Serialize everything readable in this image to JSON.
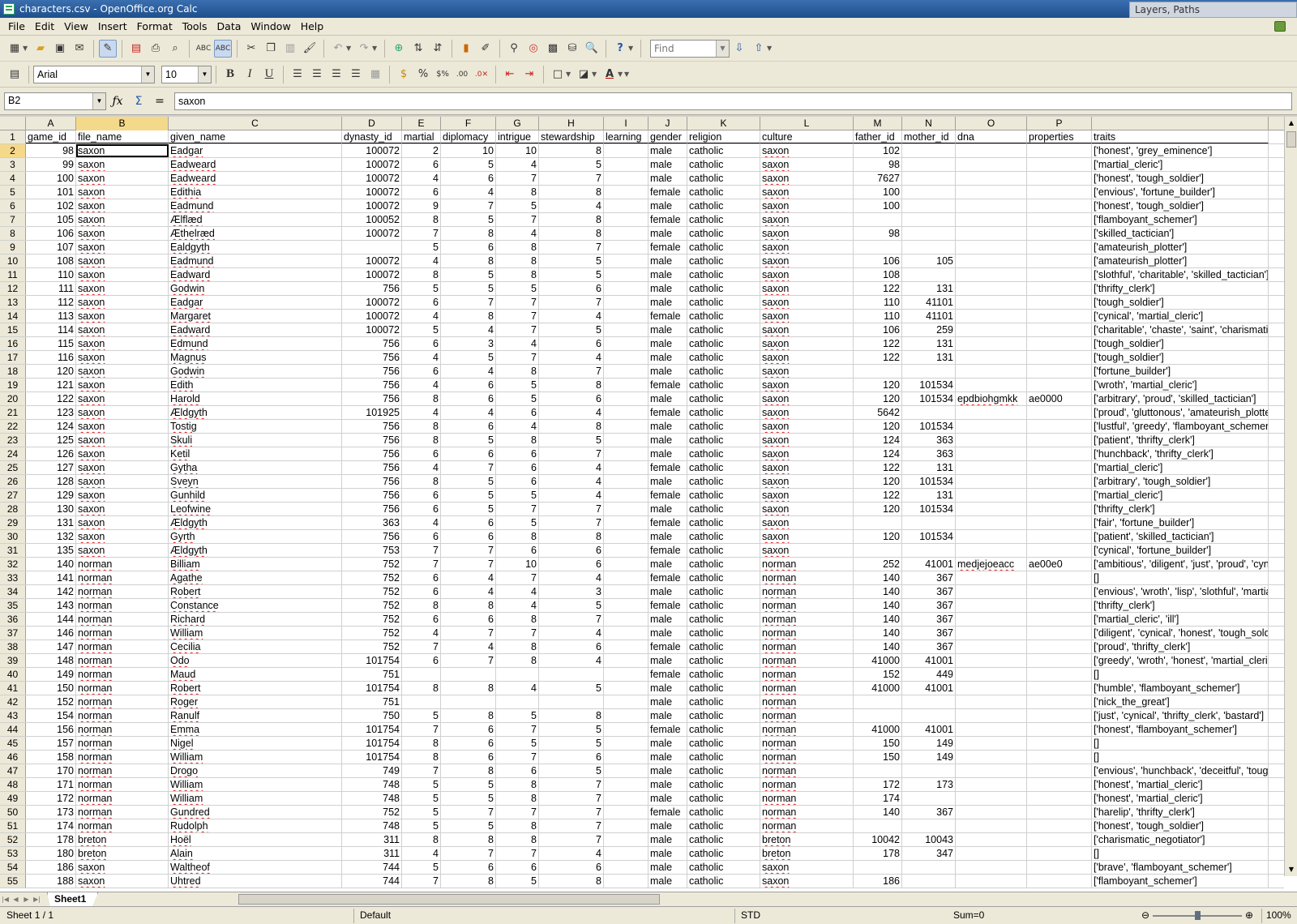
{
  "window": {
    "title": "characters.csv - OpenOffice.org Calc",
    "background_window_title": "Layers, Paths"
  },
  "menu": [
    "File",
    "Edit",
    "View",
    "Insert",
    "Format",
    "Tools",
    "Data",
    "Window",
    "Help"
  ],
  "toolbar": {
    "find_placeholder": "Find",
    "font_name": "Arial",
    "font_size": "10"
  },
  "formula_bar": {
    "cell_ref": "B2",
    "content": "saxon"
  },
  "columns": [
    "A",
    "B",
    "C",
    "D",
    "E",
    "F",
    "G",
    "H",
    "I",
    "J",
    "K",
    "L",
    "M",
    "N",
    "O",
    "P",
    ""
  ],
  "selected_column": "B",
  "active_cell": {
    "row": 2,
    "col": "B"
  },
  "header_row": [
    "game_id",
    "file_name",
    "given_name",
    "dynasty_id",
    "martial",
    "diplomacy",
    "intrigue",
    "stewardship",
    "learning",
    "gender",
    "religion",
    "culture",
    "father_id",
    "mother_id",
    "dna",
    "properties",
    "traits"
  ],
  "rows": [
    [
      2,
      98,
      "saxon",
      "Eadgar",
      100072,
      2,
      10,
      10,
      8,
      "",
      "male",
      "catholic",
      "saxon",
      102,
      "",
      "",
      "",
      "['honest', 'grey_eminence']"
    ],
    [
      3,
      99,
      "saxon",
      "Eadweard",
      100072,
      6,
      5,
      4,
      5,
      "",
      "male",
      "catholic",
      "saxon",
      98,
      "",
      "",
      "",
      "['martial_cleric']"
    ],
    [
      4,
      100,
      "saxon",
      "Eadweard",
      100072,
      4,
      6,
      7,
      7,
      "",
      "male",
      "catholic",
      "saxon",
      7627,
      "",
      "",
      "",
      "['honest', 'tough_soldier']"
    ],
    [
      5,
      101,
      "saxon",
      "Edithia",
      100072,
      6,
      4,
      8,
      8,
      "",
      "female",
      "catholic",
      "saxon",
      100,
      "",
      "",
      "",
      "['envious', 'fortune_builder']"
    ],
    [
      6,
      102,
      "saxon",
      "Eadmund",
      100072,
      9,
      7,
      5,
      4,
      "",
      "male",
      "catholic",
      "saxon",
      100,
      "",
      "",
      "",
      "['honest', 'tough_soldier']"
    ],
    [
      7,
      105,
      "saxon",
      "Ælflæd",
      100052,
      8,
      5,
      7,
      8,
      "",
      "female",
      "catholic",
      "saxon",
      "",
      "",
      "",
      "",
      "['flamboyant_schemer']"
    ],
    [
      8,
      106,
      "saxon",
      "Æthelræd",
      100072,
      7,
      8,
      4,
      8,
      "",
      "male",
      "catholic",
      "saxon",
      98,
      "",
      "",
      "",
      "['skilled_tactician']"
    ],
    [
      9,
      107,
      "saxon",
      "Ealdgyth",
      "",
      5,
      6,
      8,
      7,
      "",
      "female",
      "catholic",
      "saxon",
      "",
      "",
      "",
      "",
      "['amateurish_plotter']"
    ],
    [
      10,
      108,
      "saxon",
      "Eadmund",
      100072,
      4,
      8,
      8,
      5,
      "",
      "male",
      "catholic",
      "saxon",
      106,
      105,
      "",
      "",
      "['amateurish_plotter']"
    ],
    [
      11,
      110,
      "saxon",
      "Eadward",
      100072,
      8,
      5,
      8,
      5,
      "",
      "male",
      "catholic",
      "saxon",
      108,
      "",
      "",
      "",
      "['slothful', 'charitable', 'skilled_tactician']"
    ],
    [
      12,
      111,
      "saxon",
      "Godwin",
      756,
      5,
      5,
      5,
      6,
      "",
      "male",
      "catholic",
      "saxon",
      122,
      131,
      "",
      "",
      "['thrifty_clerk']"
    ],
    [
      13,
      112,
      "saxon",
      "Eadgar",
      100072,
      6,
      7,
      7,
      7,
      "",
      "male",
      "catholic",
      "saxon",
      110,
      41101,
      "",
      "",
      "['tough_soldier']"
    ],
    [
      14,
      113,
      "saxon",
      "Margaret",
      100072,
      4,
      8,
      7,
      4,
      "",
      "female",
      "catholic",
      "saxon",
      110,
      41101,
      "",
      "",
      "['cynical', 'martial_cleric']"
    ],
    [
      15,
      114,
      "saxon",
      "Eadward",
      100072,
      5,
      4,
      7,
      5,
      "",
      "male",
      "catholic",
      "saxon",
      106,
      259,
      "",
      "",
      "['charitable', 'chaste', 'saint', 'charismatic_negotiator']"
    ],
    [
      16,
      115,
      "saxon",
      "Edmund",
      756,
      6,
      3,
      4,
      6,
      "",
      "male",
      "catholic",
      "saxon",
      122,
      131,
      "",
      "",
      "['tough_soldier']"
    ],
    [
      17,
      116,
      "saxon",
      "Magnus",
      756,
      4,
      5,
      7,
      4,
      "",
      "male",
      "catholic",
      "saxon",
      122,
      131,
      "",
      "",
      "['tough_soldier']"
    ],
    [
      18,
      120,
      "saxon",
      "Godwin",
      756,
      6,
      4,
      8,
      7,
      "",
      "male",
      "catholic",
      "saxon",
      "",
      "",
      "",
      "",
      "['fortune_builder']"
    ],
    [
      19,
      121,
      "saxon",
      "Edith",
      756,
      4,
      6,
      5,
      8,
      "",
      "female",
      "catholic",
      "saxon",
      120,
      101534,
      "",
      "",
      "['wroth', 'martial_cleric']"
    ],
    [
      20,
      122,
      "saxon",
      "Harold",
      756,
      8,
      6,
      5,
      6,
      "",
      "male",
      "catholic",
      "saxon",
      120,
      101534,
      "epdbiohgmkk",
      "ae0000",
      "['arbitrary', 'proud', 'skilled_tactician']"
    ],
    [
      21,
      123,
      "saxon",
      "Ældgyth",
      101925,
      4,
      4,
      6,
      4,
      "",
      "female",
      "catholic",
      "saxon",
      5642,
      "",
      "",
      "",
      "['proud', 'gluttonous', 'amateurish_plotter']"
    ],
    [
      22,
      124,
      "saxon",
      "Tostig",
      756,
      8,
      6,
      4,
      8,
      "",
      "male",
      "catholic",
      "saxon",
      120,
      101534,
      "",
      "",
      "['lustful', 'greedy', 'flamboyant_schemer']"
    ],
    [
      23,
      125,
      "saxon",
      "Skuli",
      756,
      8,
      5,
      8,
      5,
      "",
      "male",
      "catholic",
      "saxon",
      124,
      363,
      "",
      "",
      "['patient', 'thrifty_clerk']"
    ],
    [
      24,
      126,
      "saxon",
      "Ketil",
      756,
      6,
      6,
      6,
      7,
      "",
      "male",
      "catholic",
      "saxon",
      124,
      363,
      "",
      "",
      "['hunchback', 'thrifty_clerk']"
    ],
    [
      25,
      127,
      "saxon",
      "Gytha",
      756,
      4,
      7,
      6,
      4,
      "",
      "female",
      "catholic",
      "saxon",
      122,
      131,
      "",
      "",
      "['martial_cleric']"
    ],
    [
      26,
      128,
      "saxon",
      "Sveyn",
      756,
      8,
      5,
      6,
      4,
      "",
      "male",
      "catholic",
      "saxon",
      120,
      101534,
      "",
      "",
      "['arbitrary', 'tough_soldier']"
    ],
    [
      27,
      129,
      "saxon",
      "Gunhild",
      756,
      6,
      5,
      5,
      4,
      "",
      "female",
      "catholic",
      "saxon",
      122,
      131,
      "",
      "",
      "['martial_cleric']"
    ],
    [
      28,
      130,
      "saxon",
      "Leofwine",
      756,
      6,
      5,
      7,
      7,
      "",
      "male",
      "catholic",
      "saxon",
      120,
      101534,
      "",
      "",
      "['thrifty_clerk']"
    ],
    [
      29,
      131,
      "saxon",
      "Ældgyth",
      363,
      4,
      6,
      5,
      7,
      "",
      "female",
      "catholic",
      "saxon",
      "",
      "",
      "",
      "",
      "['fair', 'fortune_builder']"
    ],
    [
      30,
      132,
      "saxon",
      "Gyrth",
      756,
      6,
      6,
      8,
      8,
      "",
      "male",
      "catholic",
      "saxon",
      120,
      101534,
      "",
      "",
      "['patient', 'skilled_tactician']"
    ],
    [
      31,
      135,
      "saxon",
      "Ældgyth",
      753,
      7,
      7,
      6,
      6,
      "",
      "female",
      "catholic",
      "saxon",
      "",
      "",
      "",
      "",
      "['cynical', 'fortune_builder']"
    ],
    [
      32,
      140,
      "norman",
      "Billiam",
      752,
      7,
      7,
      10,
      6,
      "",
      "male",
      "catholic",
      "norman",
      252,
      41001,
      "medjejoeacc",
      "ae00e0",
      "['ambitious', 'diligent', 'just', 'proud', 'cynical']"
    ],
    [
      33,
      141,
      "norman",
      "Agathe",
      752,
      6,
      4,
      7,
      4,
      "",
      "female",
      "catholic",
      "norman",
      140,
      367,
      "",
      "",
      "[]"
    ],
    [
      34,
      142,
      "norman",
      "Robert",
      752,
      6,
      4,
      4,
      3,
      "",
      "male",
      "catholic",
      "norman",
      140,
      367,
      "",
      "",
      "['envious', 'wroth', 'lisp', 'slothful', 'martial_cleric']"
    ],
    [
      35,
      143,
      "norman",
      "Constance",
      752,
      8,
      8,
      4,
      5,
      "",
      "female",
      "catholic",
      "norman",
      140,
      367,
      "",
      "",
      "['thrifty_clerk']"
    ],
    [
      36,
      144,
      "norman",
      "Richard",
      752,
      6,
      6,
      8,
      7,
      "",
      "male",
      "catholic",
      "norman",
      140,
      367,
      "",
      "",
      "['martial_cleric', 'ill']"
    ],
    [
      37,
      146,
      "norman",
      "William",
      752,
      4,
      7,
      7,
      4,
      "",
      "male",
      "catholic",
      "norman",
      140,
      367,
      "",
      "",
      "['diligent', 'cynical', 'honest', 'tough_soldier']"
    ],
    [
      38,
      147,
      "norman",
      "Cecilia",
      752,
      7,
      4,
      8,
      6,
      "",
      "female",
      "catholic",
      "norman",
      140,
      367,
      "",
      "",
      "['proud', 'thrifty_clerk']"
    ],
    [
      39,
      148,
      "norman",
      "Odo",
      101754,
      6,
      7,
      8,
      4,
      "",
      "male",
      "catholic",
      "norman",
      41000,
      41001,
      "",
      "",
      "['greedy', 'wroth', 'honest', 'martial_cleric']"
    ],
    [
      40,
      149,
      "norman",
      "Maud",
      751,
      "",
      "",
      "",
      "",
      "",
      "female",
      "catholic",
      "norman",
      152,
      449,
      "",
      "",
      "[]"
    ],
    [
      41,
      150,
      "norman",
      "Robert",
      101754,
      8,
      8,
      4,
      5,
      "",
      "male",
      "catholic",
      "norman",
      41000,
      41001,
      "",
      "",
      "['humble', 'flamboyant_schemer']"
    ],
    [
      42,
      152,
      "norman",
      "Roger",
      751,
      "",
      "",
      "",
      "",
      "",
      "male",
      "catholic",
      "norman",
      "",
      "",
      "",
      "",
      "['nick_the_great']"
    ],
    [
      43,
      154,
      "norman",
      "Ranulf",
      750,
      5,
      8,
      5,
      8,
      "",
      "male",
      "catholic",
      "norman",
      "",
      "",
      "",
      "",
      "['just', 'cynical', 'thrifty_clerk', 'bastard']"
    ],
    [
      44,
      156,
      "norman",
      "Emma",
      101754,
      7,
      6,
      7,
      5,
      "",
      "female",
      "catholic",
      "norman",
      41000,
      41001,
      "",
      "",
      "['honest', 'flamboyant_schemer']"
    ],
    [
      45,
      157,
      "norman",
      "Nigel",
      101754,
      8,
      6,
      5,
      5,
      "",
      "male",
      "catholic",
      "norman",
      150,
      149,
      "",
      "",
      "[]"
    ],
    [
      46,
      158,
      "norman",
      "William",
      101754,
      8,
      6,
      7,
      6,
      "",
      "male",
      "catholic",
      "norman",
      150,
      149,
      "",
      "",
      "[]"
    ],
    [
      47,
      170,
      "norman",
      "Drogo",
      749,
      7,
      8,
      6,
      5,
      "",
      "male",
      "catholic",
      "norman",
      "",
      "",
      "",
      "",
      "['envious', 'hunchback', 'deceitful', 'tough_soldier']"
    ],
    [
      48,
      171,
      "norman",
      "William",
      748,
      5,
      5,
      8,
      7,
      "",
      "male",
      "catholic",
      "norman",
      172,
      173,
      "",
      "",
      "['honest', 'martial_cleric']"
    ],
    [
      49,
      172,
      "norman",
      "William",
      748,
      5,
      5,
      8,
      7,
      "",
      "male",
      "catholic",
      "norman",
      174,
      "",
      "",
      "",
      "['honest', 'martial_cleric']"
    ],
    [
      50,
      173,
      "norman",
      "Gundred",
      752,
      5,
      7,
      7,
      7,
      "",
      "female",
      "catholic",
      "norman",
      140,
      367,
      "",
      "",
      "['harelip', 'thrifty_clerk']"
    ],
    [
      51,
      174,
      "norman",
      "Rudolph",
      748,
      5,
      5,
      8,
      7,
      "",
      "male",
      "catholic",
      "norman",
      "",
      "",
      "",
      "",
      "['honest', 'tough_soldier']"
    ],
    [
      52,
      178,
      "breton",
      "Hoël",
      311,
      8,
      8,
      8,
      7,
      "",
      "male",
      "catholic",
      "breton",
      10042,
      10043,
      "",
      "",
      "['charismatic_negotiator']"
    ],
    [
      53,
      180,
      "breton",
      "Alain",
      311,
      4,
      7,
      7,
      4,
      "",
      "male",
      "catholic",
      "breton",
      178,
      347,
      "",
      "",
      "[]"
    ],
    [
      54,
      186,
      "saxon",
      "Waltheof",
      744,
      5,
      6,
      6,
      6,
      "",
      "male",
      "catholic",
      "saxon",
      "",
      "",
      "",
      "",
      "['brave', 'flamboyant_schemer']"
    ],
    [
      55,
      188,
      "saxon",
      "Uhtred",
      744,
      7,
      8,
      5,
      8,
      "",
      "male",
      "catholic",
      "saxon",
      186,
      "",
      "",
      "",
      "['flamboyant_schemer']"
    ]
  ],
  "sheet_tab": "Sheet1",
  "status": {
    "sheet": "Sheet 1 / 1",
    "page_style": "Default",
    "mode": "STD",
    "sum": "Sum=0",
    "zoom": "100%"
  }
}
